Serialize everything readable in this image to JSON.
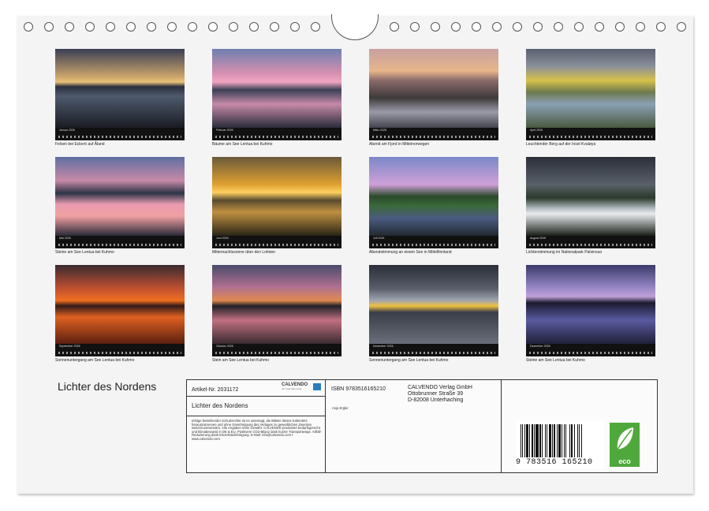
{
  "calendar": {
    "title": "Lichter des Nordens",
    "months": [
      {
        "month": "Januar",
        "year": "2026",
        "caption": "Felsen bei Eckerö auf Åland"
      },
      {
        "month": "Februar",
        "year": "2026",
        "caption": "Bäume am See Lentua bei Kuhmo"
      },
      {
        "month": "März",
        "year": "2026",
        "caption": "Abend am Fjord in Mittelnorwegen"
      },
      {
        "month": "April",
        "year": "2026",
        "caption": "Leuchtender Berg auf der Insel Kvaløya"
      },
      {
        "month": "Mai",
        "year": "2026",
        "caption": "Steine am See Lentua bei Kuhmo"
      },
      {
        "month": "Juni",
        "year": "2026",
        "caption": "Mitternachtssonne über den Lofoten"
      },
      {
        "month": "Juli",
        "year": "2026",
        "caption": "Abendstimmung an einem See in Mittelfinnland"
      },
      {
        "month": "August",
        "year": "2026",
        "caption": "Lichterstimmung im Nationalpark Patvinsuo"
      },
      {
        "month": "September",
        "year": "2026",
        "caption": "Sonnenuntergang am See Lentua bei Kuhmo"
      },
      {
        "month": "Oktober",
        "year": "2026",
        "caption": "Stein am See Lentua bei Kuhmo"
      },
      {
        "month": "November",
        "year": "2026",
        "caption": "Sonnenuntergang am See Lentua bei Kuhmo"
      },
      {
        "month": "Dezember",
        "year": "2026",
        "caption": "Steine am See Lentua bei Kuhmo"
      }
    ]
  },
  "info": {
    "article": "Artikel-Nr. 2031172",
    "brand": "CALVENDO",
    "brand_sub": "der Kalenderverlag",
    "title": "Lichter des Nordens",
    "legal": "Infolge bestehender Schutzrechte ist es untersagt, die Blätter dieses Kalenders herauszutrennen und ohne Genehmigung des Verlages zu gewerblichen Zwecken weiterzuverwenden. Alle Angaben ohne Gewähr. CALVENDO produziert bedarfsgerecht und klimabewusst in DE & EU. Positivere CO2-Bilanz dank kurzer Transportwege. Abfall-Reduzierung dank Einzelstückfertigung. E-Mail: info@calvendo.com • www.calvendo.com",
    "isbn": "ISBN 9783516165210",
    "publisher_line1": "CALVENDO Verlag GmbH",
    "publisher_line2": "Ottobrunner Straße 39",
    "publisher_line3": "D-82008 Unterhaching",
    "author": "Anja Ergler",
    "barcode_number": "9 783516 165210",
    "eco_label": "eco"
  },
  "colors": {
    "sheet": "#f4f4f4",
    "eco_green": "#4fa83b",
    "calvendo_blue": "#2a7fb8"
  }
}
